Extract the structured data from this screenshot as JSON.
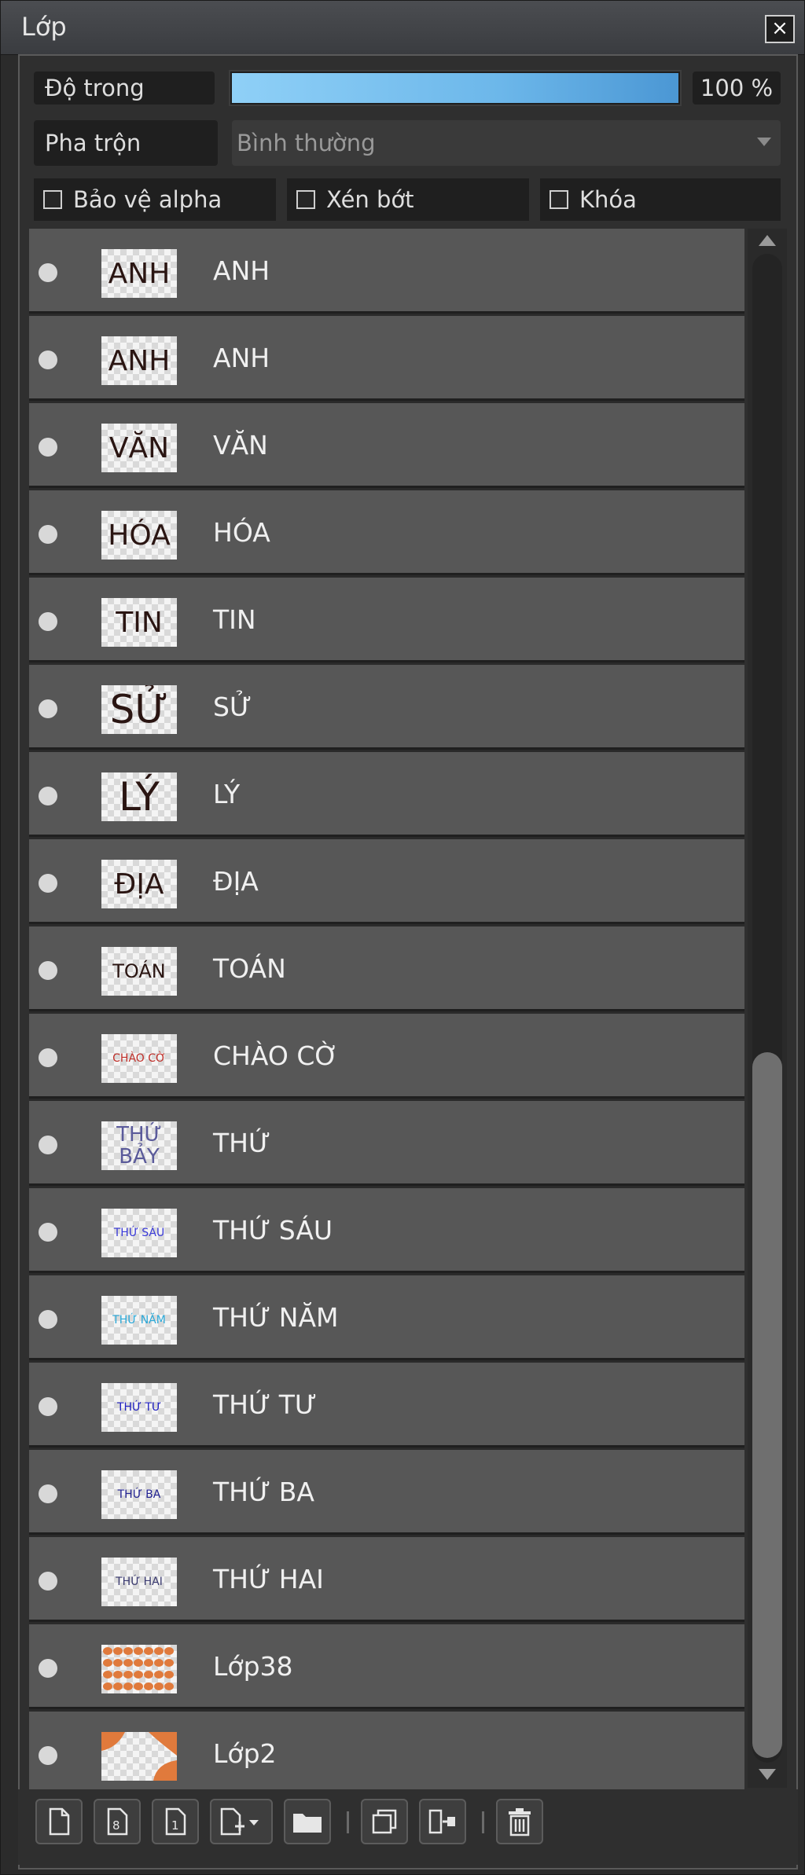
{
  "window": {
    "title": "Lớp",
    "close_label": "×"
  },
  "controls": {
    "opacity_label": "Độ trong",
    "opacity_value": "100 %",
    "opacity_fraction": 1.0,
    "blend_label": "Pha trộn",
    "blend_value": "Bình thường",
    "protect_alpha_label": "Bảo vệ alpha",
    "clip_label": "Xén bớt",
    "lock_label": "Khóa"
  },
  "colors": {
    "accent": "#6cb7ea",
    "row_bg": "#575757",
    "panel_bg": "#2b2b2b"
  },
  "layers": [
    {
      "name": "ANH",
      "thumb_text": "ANH",
      "thumb_color": "#2a1512"
    },
    {
      "name": "ANH",
      "thumb_text": "ANH",
      "thumb_color": "#2a1512"
    },
    {
      "name": "VĂN",
      "thumb_text": "VĂN",
      "thumb_color": "#2a1512"
    },
    {
      "name": "HÓA",
      "thumb_text": "HÓA",
      "thumb_color": "#2a1512"
    },
    {
      "name": "TIN",
      "thumb_text": "TIN",
      "thumb_color": "#2a1512"
    },
    {
      "name": "SỬ",
      "thumb_text": "SỬ",
      "thumb_color": "#2a1512"
    },
    {
      "name": "LÝ",
      "thumb_text": "LÝ",
      "thumb_color": "#2a1512"
    },
    {
      "name": "ĐỊA",
      "thumb_text": "ĐỊA",
      "thumb_color": "#2a1512"
    },
    {
      "name": "TOÁN",
      "thumb_text": "TOÁN",
      "thumb_color": "#2a1512"
    },
    {
      "name": "CHÀO CỜ",
      "thumb_text": "CHÀO CỜ",
      "thumb_color": "#c0302a"
    },
    {
      "name": "THỨ",
      "thumb_text": "THỨ BẢY",
      "thumb_color": "#5a5a9a"
    },
    {
      "name": "THỨ SÁU",
      "thumb_text": "THỨ SÁU",
      "thumb_color": "#3a3ad8"
    },
    {
      "name": "THỨ NĂM",
      "thumb_text": "THỨ NĂM",
      "thumb_color": "#2aa8d8"
    },
    {
      "name": "THỨ TƯ",
      "thumb_text": "THỨ TƯ",
      "thumb_color": "#2020c0"
    },
    {
      "name": "THỨ BA",
      "thumb_text": "THỨ BA",
      "thumb_color": "#202090"
    },
    {
      "name": "THỨ HAI",
      "thumb_text": "THỨ HAI",
      "thumb_color": "#3a3a70"
    },
    {
      "name": "Lớp38",
      "thumb_text": "",
      "thumb_color": "#e07a3c"
    },
    {
      "name": "Lớp2",
      "thumb_text": "",
      "thumb_color": "#e07a3c"
    }
  ],
  "toolbar": {
    "buttons": [
      {
        "icon": "new-layer-icon"
      },
      {
        "icon": "new-8bit-layer-icon"
      },
      {
        "icon": "new-1bit-layer-icon"
      },
      {
        "icon": "add-layer-dropdown-icon"
      },
      {
        "icon": "folder-icon"
      },
      {
        "icon": "duplicate-layer-icon"
      },
      {
        "icon": "merge-down-icon"
      },
      {
        "icon": "trash-icon"
      }
    ]
  }
}
